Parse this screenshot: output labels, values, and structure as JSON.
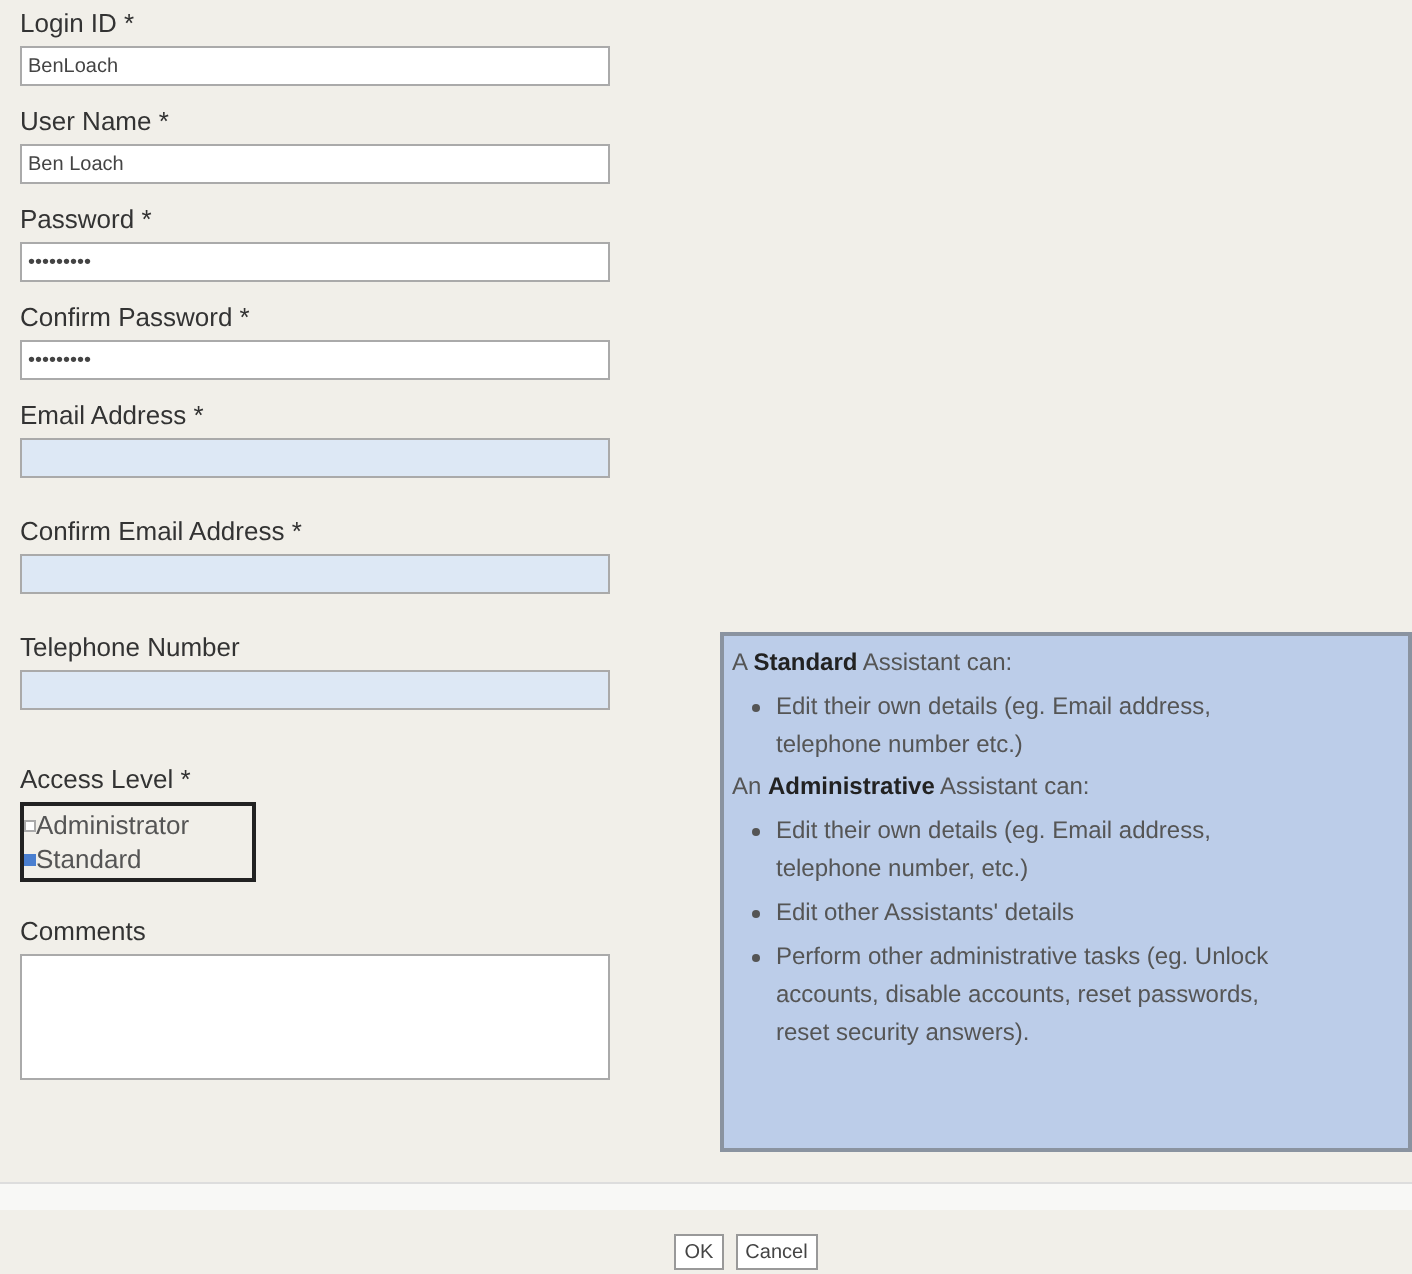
{
  "fields": [
    {
      "label": "Login ID *",
      "value": "BenLoach",
      "highlighted": false
    },
    {
      "label": "User Name *",
      "value": "Ben Loach",
      "highlighted": false
    },
    {
      "label": "Password *",
      "value": "•••••••••",
      "highlighted": false
    },
    {
      "label": "Confirm Password *",
      "value": "•••••••••",
      "highlighted": false
    },
    {
      "label": "Email Address *",
      "highlighted": true
    },
    {
      "label": "Confirm Email Address *",
      "highlighted": true
    },
    {
      "label": "Telephone Number",
      "highlighted": true
    }
  ],
  "access_level": {
    "label": "Access Level *",
    "options": [
      {
        "label": "Administrator",
        "selected": false
      },
      {
        "label": "Standard",
        "selected": true
      }
    ]
  },
  "comments": {
    "label": "Comments"
  },
  "info": {
    "sections": [
      {
        "intro": "A **Standard** Assistant can:",
        "bullets": [
          "Edit their own details (eg. Email address, telephone number etc.)"
        ]
      },
      {
        "intro": "An **Administrative** Assistant can:",
        "bullets": [
          "Edit their own details (eg. Email address, telephone number, etc.)",
          "Edit other Assistants' details",
          "Perform other administrative tasks (eg. Unlock accounts, disable accounts, reset passwords, reset security answers)."
        ]
      }
    ]
  },
  "buttons": [
    "OK",
    "Cancel"
  ]
}
